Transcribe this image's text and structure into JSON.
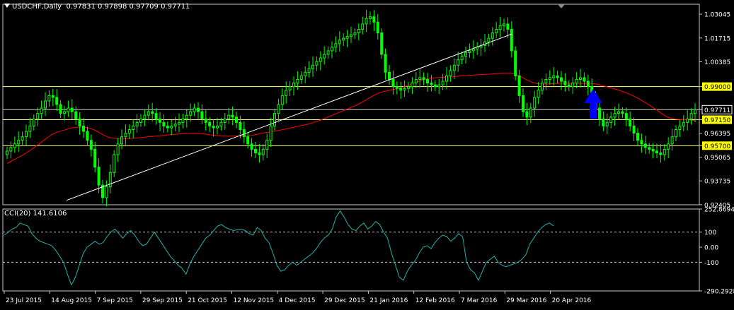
{
  "header": {
    "symbol": "USDCHF,Daily",
    "ohlc": "0.97831 0.97898 0.97709 0.97711"
  },
  "colors": {
    "background": "#000000",
    "frame": "#c8c8c8",
    "candle": "#00ff00",
    "ma": "#ff0000",
    "trendline": "#ffffff",
    "hline": "#ffff7f",
    "label_yellow": "#ffff00",
    "cci": "#20b2aa",
    "arrow": "#0000ff"
  },
  "icons": {
    "arrow": "blue-up-arrow-icon",
    "collapse": "triangle-down-icon"
  },
  "chart_data": [
    {
      "type": "candlestick",
      "title": "USDCHF,Daily",
      "ohlc_last": {
        "open": 0.97831,
        "high": 0.97898,
        "low": 0.97709,
        "close": 0.97711
      },
      "y_ticks": [
        "1.03045",
        "1.01715",
        "1.00385",
        "0.99000",
        "0.97711",
        "0.97150",
        "0.96395",
        "0.95700",
        "0.95065",
        "0.93735",
        "0.92405"
      ],
      "y_highlighted": [
        "0.99000",
        "0.97150",
        "0.95700"
      ],
      "current_price": "0.97711",
      "ylim": [
        0.924,
        1.036
      ],
      "x_labels": [
        "23 Jul 2015",
        "14 Aug 2015",
        "7 Sep 2015",
        "29 Sep 2015",
        "21 Oct 2015",
        "12 Nov 2015",
        "4 Dec 2015",
        "29 Dec 2015",
        "21 Jan 2016",
        "12 Feb 2016",
        "7 Mar 2016",
        "29 Mar 2016",
        "20 Apr 2016"
      ],
      "horizontal_levels": [
        0.99,
        0.97711,
        0.9715,
        0.957
      ],
      "trendline": {
        "from": {
          "date": "14 Aug 2015",
          "price": 0.9265
        },
        "to": {
          "date": "20 Apr 2016",
          "price": 1.0195
        }
      },
      "close_series": [
        0.954,
        0.956,
        0.958,
        0.96,
        0.962,
        0.965,
        0.968,
        0.972,
        0.975,
        0.978,
        0.982,
        0.985,
        0.984,
        0.98,
        0.975,
        0.976,
        0.978,
        0.976,
        0.972,
        0.968,
        0.965,
        0.96,
        0.955,
        0.945,
        0.935,
        0.928,
        0.934,
        0.942,
        0.952,
        0.958,
        0.962,
        0.964,
        0.966,
        0.968,
        0.97,
        0.972,
        0.974,
        0.976,
        0.975,
        0.972,
        0.97,
        0.968,
        0.967,
        0.968,
        0.969,
        0.97,
        0.972,
        0.974,
        0.976,
        0.978,
        0.976,
        0.972,
        0.97,
        0.968,
        0.967,
        0.968,
        0.97,
        0.972,
        0.974,
        0.973,
        0.97,
        0.966,
        0.962,
        0.958,
        0.955,
        0.953,
        0.952,
        0.955,
        0.96,
        0.968,
        0.975,
        0.98,
        0.985,
        0.988,
        0.99,
        0.992,
        0.994,
        0.996,
        0.998,
        1.0,
        1.002,
        1.004,
        1.006,
        1.008,
        1.01,
        1.012,
        1.014,
        1.016,
        1.017,
        1.018,
        1.019,
        1.02,
        1.022,
        1.025,
        1.028,
        1.029,
        1.026,
        1.02,
        1.008,
        0.998,
        0.994,
        0.99,
        0.989,
        0.988,
        0.989,
        0.99,
        0.992,
        0.994,
        0.995,
        0.994,
        0.992,
        0.991,
        0.99,
        0.991,
        0.993,
        0.996,
        0.999,
        1.002,
        1.005,
        1.007,
        1.009,
        1.01,
        1.011,
        1.012,
        1.013,
        1.015,
        1.017,
        1.02,
        1.022,
        1.024,
        1.025,
        1.022,
        1.01,
        0.996,
        0.985,
        0.976,
        0.973,
        0.978,
        0.984,
        0.988,
        0.992,
        0.994,
        0.995,
        0.996,
        0.995,
        0.993,
        0.991,
        0.99,
        0.992,
        0.994,
        0.995,
        0.993,
        0.99,
        0.985,
        0.978,
        0.972,
        0.968,
        0.97,
        0.973,
        0.975,
        0.976,
        0.975,
        0.972,
        0.968,
        0.964,
        0.96,
        0.958,
        0.956,
        0.955,
        0.954,
        0.953,
        0.952,
        0.955,
        0.958,
        0.962,
        0.966,
        0.968,
        0.97,
        0.972,
        0.975,
        0.977
      ]
    },
    {
      "type": "line",
      "title": "CCI(20)",
      "current_value": "141.6106",
      "y_ticks": [
        "252.8694",
        "100",
        "0.00",
        "-100",
        "-290.2928"
      ],
      "dashed_levels": [
        100,
        -100
      ],
      "ylim": [
        -290.2928,
        252.8694
      ],
      "values": [
        80,
        100,
        120,
        130,
        160,
        150,
        140,
        90,
        60,
        40,
        30,
        20,
        10,
        -20,
        -60,
        -100,
        -180,
        -250,
        -200,
        -120,
        -40,
        0,
        20,
        40,
        20,
        30,
        70,
        100,
        120,
        90,
        60,
        90,
        110,
        80,
        40,
        10,
        20,
        60,
        100,
        60,
        20,
        -20,
        -60,
        -90,
        -120,
        -140,
        -180,
        -110,
        -60,
        -20,
        20,
        60,
        80,
        110,
        140,
        150,
        130,
        120,
        110,
        115,
        120,
        110,
        90,
        80,
        130,
        110,
        60,
        30,
        -40,
        -120,
        -160,
        -150,
        -120,
        -100,
        -120,
        -100,
        -80,
        -60,
        -40,
        -10,
        30,
        60,
        80,
        120,
        200,
        240,
        200,
        150,
        120,
        110,
        140,
        160,
        120,
        140,
        170,
        150,
        100,
        60,
        -40,
        -120,
        -200,
        -220,
        -160,
        -120,
        -90,
        -40,
        0,
        10,
        -10,
        30,
        60,
        80,
        70,
        40,
        60,
        90,
        70,
        -100,
        -150,
        -170,
        -220,
        -160,
        -100,
        -80,
        -60,
        -100,
        -120,
        -130,
        -120,
        -110,
        -100,
        -80,
        -50,
        20,
        60,
        100,
        130,
        150,
        160,
        141.6106
      ]
    }
  ]
}
